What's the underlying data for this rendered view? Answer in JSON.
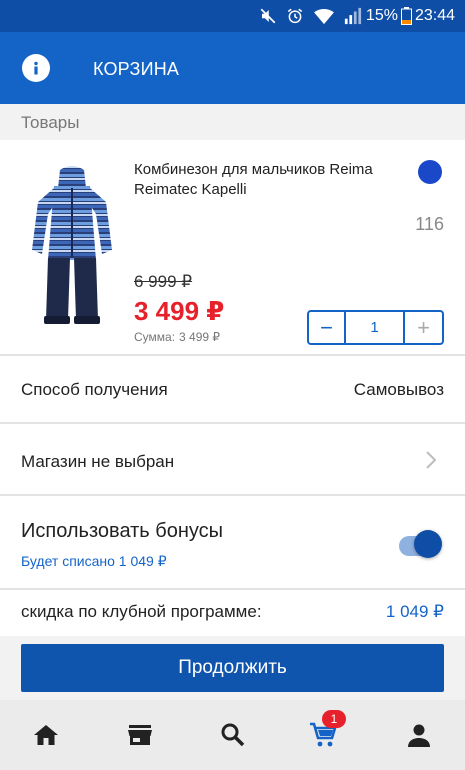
{
  "status_bar": {
    "battery_percent": "15%",
    "time": "23:44",
    "icons": [
      "mute-icon",
      "alarm-icon",
      "wifi-icon",
      "signal-icon",
      "battery-icon"
    ]
  },
  "app_bar": {
    "title": "КОРЗИНА",
    "info_icon": "info-icon"
  },
  "section": {
    "label": "Товары"
  },
  "product": {
    "name": "Комбинезон для мальчиков Reima Reimatec Kapelli",
    "color": "#1a48c9",
    "size": "116",
    "old_price": "6 999 ₽",
    "price": "3 499 ₽",
    "sum_label": "Сумма:",
    "sum_value": "3 499 ₽",
    "quantity": "1",
    "minus_label": "−",
    "plus_label": "+"
  },
  "delivery": {
    "label": "Способ получения",
    "value": "Самовывоз"
  },
  "store": {
    "label": "Магазин не выбран"
  },
  "bonus": {
    "label": "Использовать бонусы",
    "note": "Будет списано 1 049 ₽",
    "enabled": true
  },
  "discount": {
    "label": "скидка по клубной программе:",
    "value": "1 049 ₽"
  },
  "continue_button": {
    "label": "Продолжить"
  },
  "bottom_nav": {
    "items": [
      "home-icon",
      "store-icon",
      "search-icon",
      "cart-icon",
      "profile-icon"
    ],
    "cart_badge": "1"
  },
  "colors": {
    "primary": "#1464c8",
    "status_bar": "#0f4ea6",
    "price_red": "#e6212b",
    "link_blue": "#0f54ad"
  }
}
